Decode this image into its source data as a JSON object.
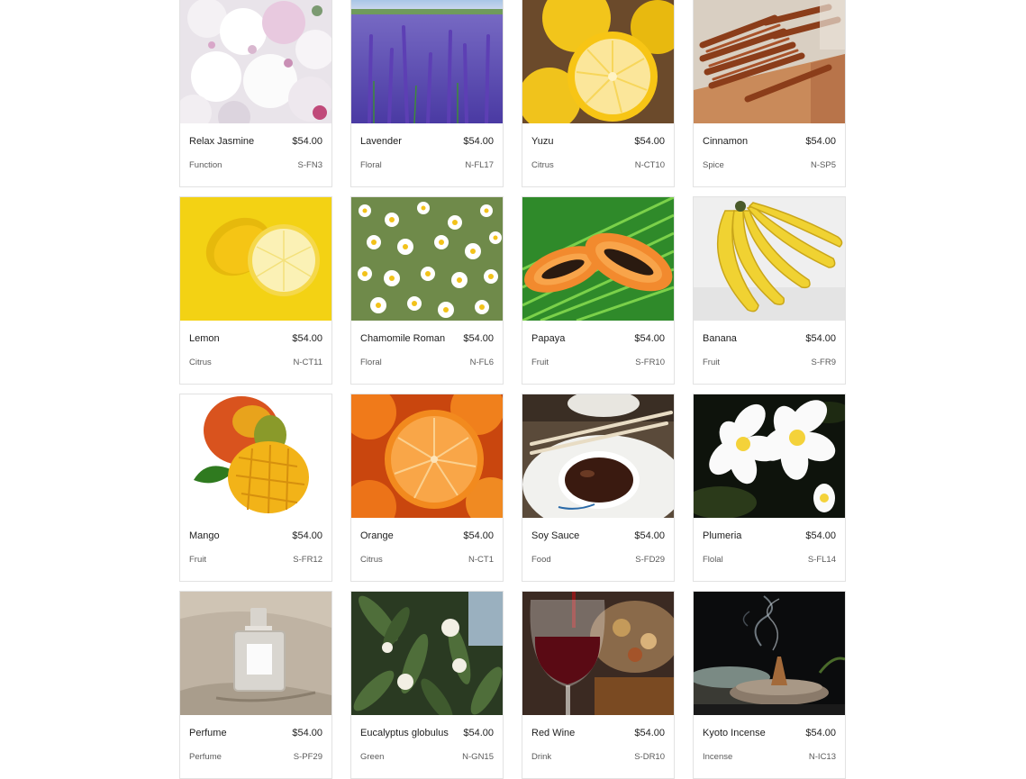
{
  "products": [
    {
      "name": "Relax Jasmine",
      "price": "$54.00",
      "category": "Function",
      "sku": "S-FN3",
      "image": "jasmine-flowers"
    },
    {
      "name": "Lavender",
      "price": "$54.00",
      "category": "Floral",
      "sku": "N-FL17",
      "image": "lavender-field"
    },
    {
      "name": "Yuzu",
      "price": "$54.00",
      "category": "Citrus",
      "sku": "N-CT10",
      "image": "yuzu-halves"
    },
    {
      "name": "Cinnamon",
      "price": "$54.00",
      "category": "Spice",
      "sku": "N-SP5",
      "image": "cinnamon-sticks"
    },
    {
      "name": "Lemon",
      "price": "$54.00",
      "category": "Citrus",
      "sku": "N-CT11",
      "image": "lemon-halves"
    },
    {
      "name": "Chamomile Roman",
      "price": "$54.00",
      "category": "Floral",
      "sku": "N-FL6",
      "image": "chamomile-flowers"
    },
    {
      "name": "Papaya",
      "price": "$54.00",
      "category": "Fruit",
      "sku": "S-FR10",
      "image": "papaya-halves"
    },
    {
      "name": "Banana",
      "price": "$54.00",
      "category": "Fruit",
      "sku": "S-FR9",
      "image": "banana-bunch"
    },
    {
      "name": "Mango",
      "price": "$54.00",
      "category": "Fruit",
      "sku": "S-FR12",
      "image": "mango-cut"
    },
    {
      "name": "Orange",
      "price": "$54.00",
      "category": "Citrus",
      "sku": "N-CT1",
      "image": "orange-slices"
    },
    {
      "name": "Soy Sauce",
      "price": "$54.00",
      "category": "Food",
      "sku": "S-FD29",
      "image": "soy-sauce-bowl"
    },
    {
      "name": "Plumeria",
      "price": "$54.00",
      "category": "Flolal",
      "sku": "S-FL14",
      "image": "plumeria-flowers"
    },
    {
      "name": "Perfume",
      "price": "$54.00",
      "category": "Perfume",
      "sku": "S-PF29",
      "image": "perfume-bottle"
    },
    {
      "name": "Eucalyptus globulus",
      "price": "$54.00",
      "category": "Green",
      "sku": "N-GN15",
      "image": "eucalyptus-leaves"
    },
    {
      "name": "Red Wine",
      "price": "$54.00",
      "category": "Drink",
      "sku": "S-DR10",
      "image": "red-wine-glass"
    },
    {
      "name": "Kyoto Incense",
      "price": "$54.00",
      "category": "Incense",
      "sku": "N-IC13",
      "image": "incense-burner"
    }
  ]
}
